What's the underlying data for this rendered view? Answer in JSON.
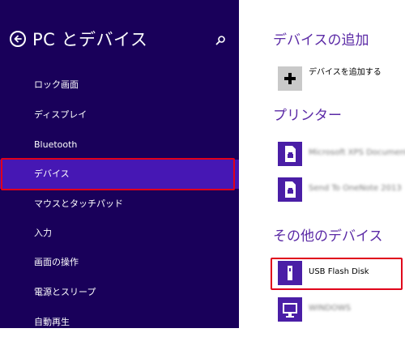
{
  "colors": {
    "sidebar_bg": "#19005a",
    "selected_bg": "#4617b4",
    "accent_text": "#5b2aa6",
    "highlight": "#e0001b"
  },
  "header": {
    "back_icon": "back-arrow-icon",
    "title": "PC とデバイス",
    "search_icon": "search-icon"
  },
  "sidebar": {
    "items": [
      {
        "label": "ロック画面"
      },
      {
        "label": "ディスプレイ"
      },
      {
        "label": "Bluetooth"
      },
      {
        "label": "デバイス",
        "selected": true
      },
      {
        "label": "マウスとタッチパッド"
      },
      {
        "label": "入力"
      },
      {
        "label": "画面の操作"
      },
      {
        "label": "電源とスリープ"
      },
      {
        "label": "自動再生"
      }
    ]
  },
  "main": {
    "add_devices": {
      "title": "デバイスの追加",
      "add_label": "デバイスを追加する",
      "add_icon": "plus-icon"
    },
    "printers": {
      "title": "プリンター",
      "items": [
        {
          "label": "Microsoft XPS Document",
          "icon": "printer-icon"
        },
        {
          "label": "Send To OneNote 2013",
          "icon": "printer-icon"
        }
      ]
    },
    "other_devices": {
      "title": "その他のデバイス",
      "items": [
        {
          "label": "USB Flash Disk",
          "icon": "usb-drive-icon"
        },
        {
          "label": "WINDOWS",
          "icon": "monitor-icon"
        }
      ]
    }
  }
}
